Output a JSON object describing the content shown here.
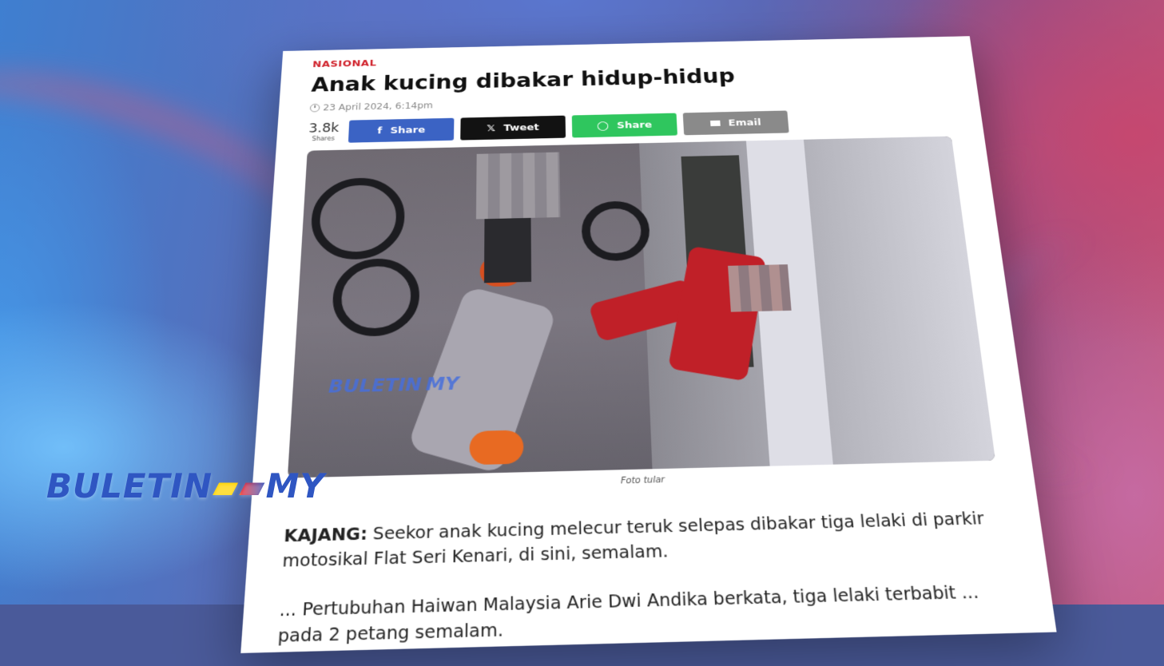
{
  "article": {
    "section": "NASIONAL",
    "title": "Anak kucing dibakar hidup-hidup",
    "date": "23 April 2024, 6:14pm",
    "share_count": "3.8k",
    "share_count_label": "Shares",
    "buttons": {
      "facebook": "Share",
      "twitter": "Tweet",
      "whatsapp": "Share",
      "email": "Email"
    },
    "photo_watermark": "BULETIN MY",
    "photo_caption": "Foto tular",
    "paragraph1_dateline": "KAJANG:",
    "paragraph1_text": " Seekor anak kucing melecur teruk selepas dibakar tiga lelaki di parkir motosikal Flat Seri Kenari, di sini, semalam.",
    "paragraph2_text": "... Pertubuhan Haiwan Malaysia Arie Dwi Andika berkata, tiga lelaki terbabit ... pada 2 petang semalam."
  },
  "broadcaster": {
    "left": "BULETIN",
    "middle": " ",
    "right": "MY"
  },
  "colors": {
    "section_red": "#d0202a",
    "facebook": "#3b63c4",
    "twitter": "#121212",
    "whatsapp": "#2fc65e",
    "email": "#8a8a8a",
    "brand_blue": "#2f56c2"
  },
  "icons": {
    "clock": "clock-icon",
    "facebook": "facebook-icon",
    "twitter": "x-icon",
    "whatsapp": "whatsapp-icon",
    "email": "mail-icon"
  }
}
